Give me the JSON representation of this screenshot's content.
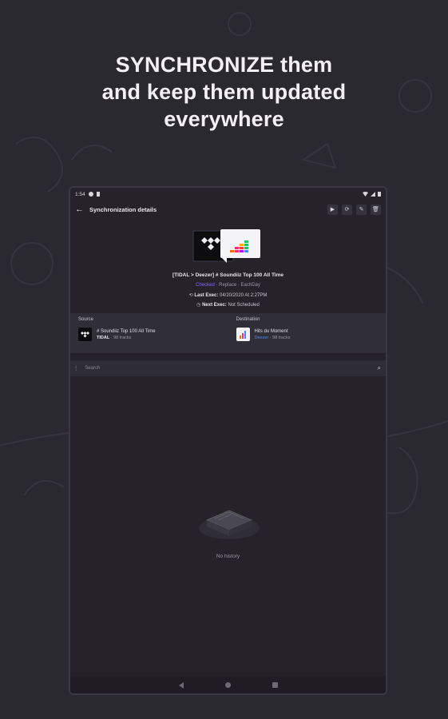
{
  "headline": {
    "line1": "SYNCHRONIZE them",
    "line2": "and keep them updated",
    "line3": "everywhere"
  },
  "status_bar": {
    "time": "1:54"
  },
  "toolbar": {
    "title": "Synchronization details",
    "back_icon": "arrow-back-icon",
    "actions": [
      "play-icon",
      "sync-icon",
      "edit-icon",
      "delete-icon"
    ]
  },
  "sync": {
    "title": "[TIDAL > Deezer] # Soundiiz Top 100 All Time",
    "status": "Checked",
    "mode": "Replace",
    "frequency": "EachDay",
    "last_exec_label": "Last Exec:",
    "last_exec_value": "04/20/2020 At 2:27PM",
    "next_exec_label": "Next Exec:",
    "next_exec_value": "Not Scheduled"
  },
  "source": {
    "label": "Source",
    "name": "# Soundiiz Top 100 All Time",
    "service": "TIDAL",
    "tracks": "98 tracks"
  },
  "destination": {
    "label": "Destination",
    "name": "Hits du Moment",
    "service": "Deezer",
    "tracks": "98 tracks"
  },
  "search": {
    "placeholder": "Search"
  },
  "empty": {
    "text": "No history"
  },
  "colors": {
    "background": "#2b2930",
    "accent_purple": "#8a6cff",
    "deezer_blue": "#4a8cff"
  }
}
